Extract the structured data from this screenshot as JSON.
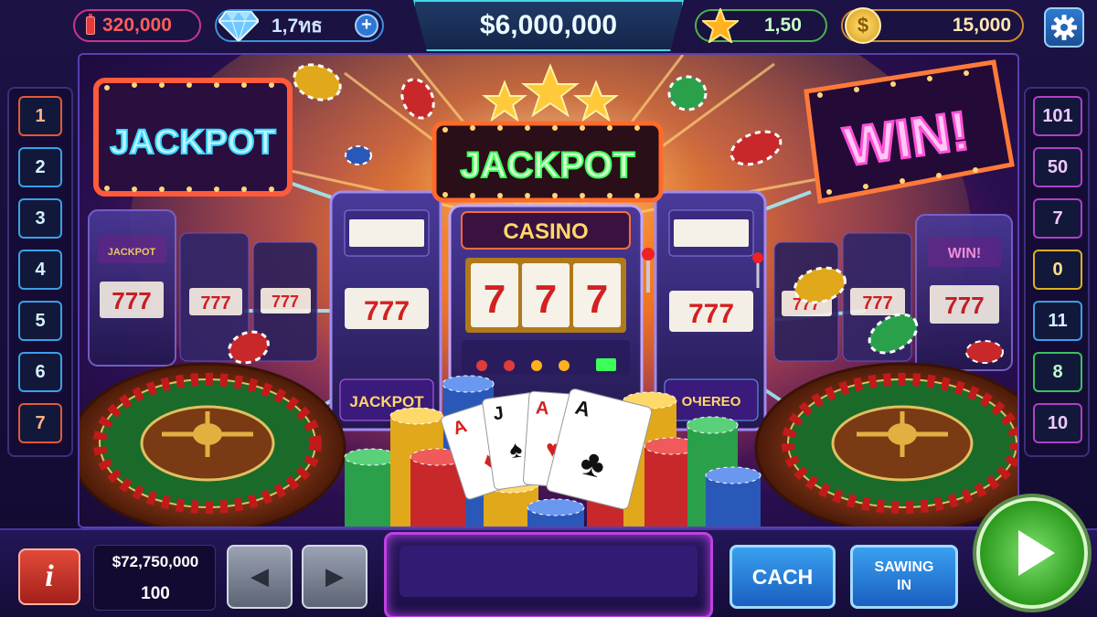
{
  "hud": {
    "cash": "320,000",
    "gems": "1,7ทธ",
    "gems_add_label": "+",
    "jackpot": "$6,000,000",
    "stars": "1,50",
    "coins": "15,000",
    "coin_symbol": "$",
    "settings_icon": "gear-icon"
  },
  "left_numbers": [
    "1",
    "2",
    "3",
    "4",
    "5",
    "6",
    "7"
  ],
  "right_numbers": [
    "101",
    "50",
    "7",
    "0",
    "11",
    "8",
    "10"
  ],
  "scene": {
    "sign_left": "JACKPOT",
    "sign_center": "JACKPOT",
    "sign_right": "WIN!",
    "casino_label": "CASINO",
    "reel_symbols": [
      "7",
      "7",
      "7"
    ],
    "side_machine_left_label": "JACKPOT",
    "side_machine_right_label": "WIN!",
    "machine_panel_left": "JACKPOT",
    "machine_panel_right": "ОЧЕRЕО",
    "far_left_machine_label": "JACKPOT",
    "cards": [
      "A",
      "J",
      "A",
      "A"
    ]
  },
  "bottom": {
    "info_label": "i",
    "bet_total": "$72,750,000",
    "bet_lines": "100",
    "prev_icon": "left-arrow-icon",
    "next_icon": "right-arrow-icon",
    "cash_label": "CACH",
    "saving_label_line1": "SAWING",
    "saving_label_line2": "IN",
    "play_icon": "play-icon"
  },
  "colors": {
    "neon_blue": "#38d8ff",
    "neon_green": "#3cff5a",
    "neon_pink": "#ff4fd8",
    "gold": "#ffc93a",
    "play_green": "#2c9a1e"
  }
}
